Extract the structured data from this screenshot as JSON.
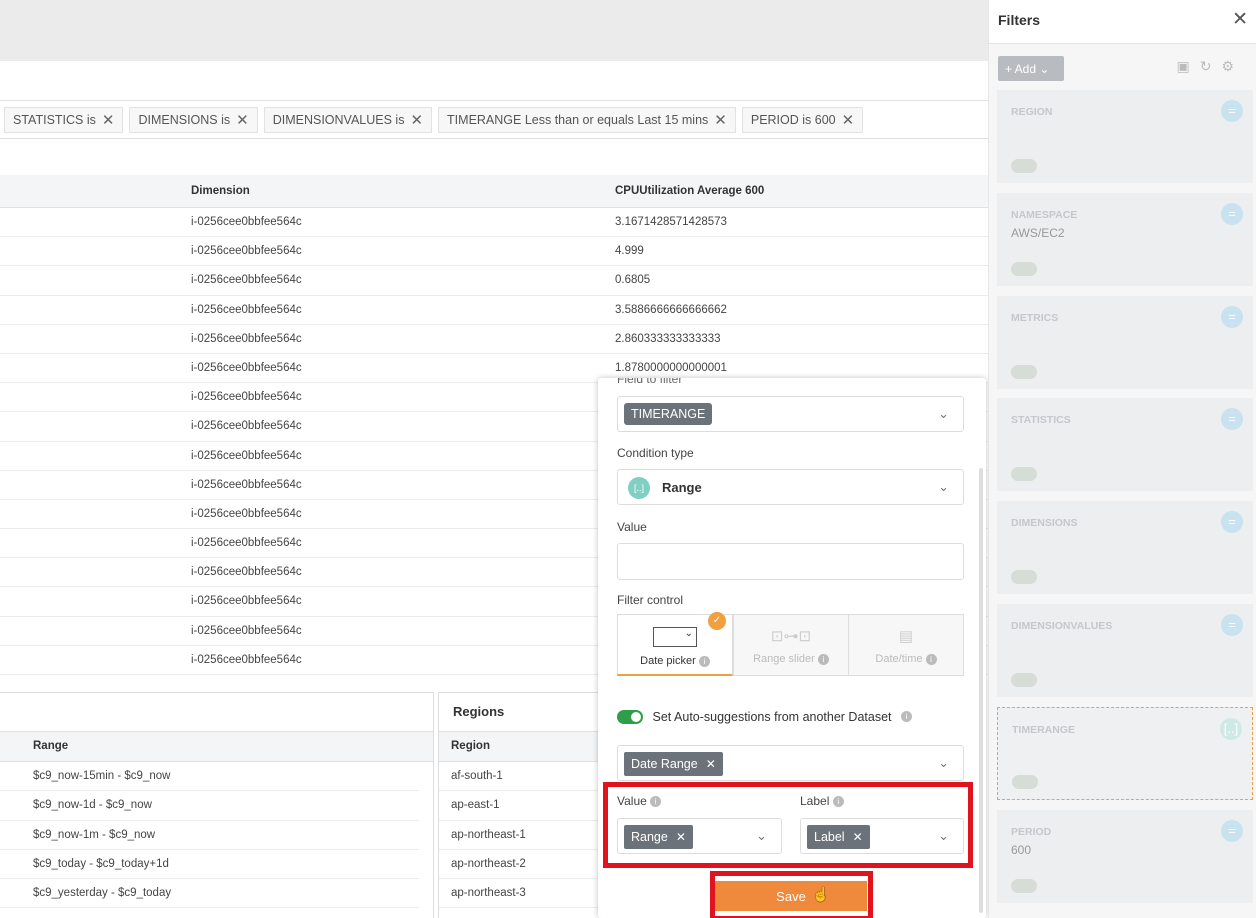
{
  "filter_chips": [
    {
      "label": "STATISTICS is"
    },
    {
      "label": "DIMENSIONS is"
    },
    {
      "label": "DIMENSIONVALUES is"
    },
    {
      "label": "TIMERANGE Less than or equals Last 15 mins"
    },
    {
      "label": "PERIOD is 600"
    }
  ],
  "main_table": {
    "headers": [
      "Dimension",
      "CPUUtilization Average 600"
    ],
    "rows": [
      [
        "i-0256cee0bbfee564c",
        "3.1671428571428573"
      ],
      [
        "i-0256cee0bbfee564c",
        "4.999"
      ],
      [
        "i-0256cee0bbfee564c",
        "0.6805"
      ],
      [
        "i-0256cee0bbfee564c",
        "3.5886666666666662"
      ],
      [
        "i-0256cee0bbfee564c",
        "2.860333333333333"
      ],
      [
        "i-0256cee0bbfee564c",
        "1.8780000000000001"
      ],
      [
        "i-0256cee0bbfee564c",
        ""
      ],
      [
        "i-0256cee0bbfee564c",
        ""
      ],
      [
        "i-0256cee0bbfee564c",
        ""
      ],
      [
        "i-0256cee0bbfee564c",
        ""
      ],
      [
        "i-0256cee0bbfee564c",
        ""
      ],
      [
        "i-0256cee0bbfee564c",
        ""
      ],
      [
        "i-0256cee0bbfee564c",
        ""
      ],
      [
        "i-0256cee0bbfee564c",
        ""
      ],
      [
        "i-0256cee0bbfee564c",
        ""
      ],
      [
        "i-0256cee0bbfee564c",
        ""
      ]
    ]
  },
  "ranges_table": {
    "header": "Range",
    "rows": [
      "$c9_now-15min - $c9_now",
      "$c9_now-1d - $c9_now",
      "$c9_now-1m - $c9_now",
      "$c9_today - $c9_today+1d",
      "$c9_yesterday - $c9_today"
    ]
  },
  "regions_panel": {
    "title": "Regions",
    "header": "Region",
    "rows": [
      "af-south-1",
      "ap-east-1",
      "ap-northeast-1",
      "ap-northeast-2",
      "ap-northeast-3"
    ]
  },
  "popup": {
    "field_label": "Field to filter",
    "field_value": "TIMERANGE",
    "condition_label": "Condition type",
    "condition_value": "Range",
    "condition_icon": "[..]",
    "value_label": "Value",
    "filter_control_label": "Filter control",
    "controls": [
      {
        "label": "Date picker",
        "active": true
      },
      {
        "label": "Range slider",
        "active": false
      },
      {
        "label": "Date/time",
        "active": false
      }
    ],
    "autosuggest_label": "Set Auto-suggestions from another Dataset",
    "dataset_tag": "Date Range",
    "value_field_label": "Value",
    "value_field_tag": "Range",
    "label_field_label": "Label",
    "label_field_tag": "Label",
    "save_label": "Save"
  },
  "sidebar": {
    "title": "Filters",
    "add_label": "+ Add",
    "cards": [
      {
        "name": "REGION",
        "value": "",
        "badge": "="
      },
      {
        "name": "NAMESPACE",
        "value": "AWS/EC2",
        "badge": "="
      },
      {
        "name": "METRICS",
        "value": "",
        "badge": "="
      },
      {
        "name": "STATISTICS",
        "value": "",
        "badge": "="
      },
      {
        "name": "DIMENSIONS",
        "value": "",
        "badge": "="
      },
      {
        "name": "DIMENSIONVALUES",
        "value": "",
        "badge": "="
      },
      {
        "name": "TIMERANGE",
        "value": "",
        "badge": "[..]"
      },
      {
        "name": "PERIOD",
        "value": "600",
        "badge": "="
      }
    ]
  },
  "colors": {
    "accent": "#ef8a3c",
    "highlight": "#e0141e",
    "toggle": "#2e9e4a"
  }
}
